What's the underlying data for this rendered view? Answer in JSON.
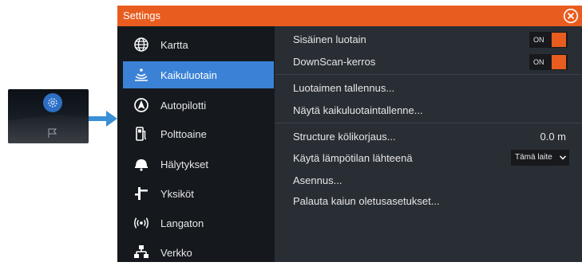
{
  "window": {
    "title": "Settings"
  },
  "sidebar": {
    "items": [
      {
        "label": "Kartta",
        "icon": "globe-icon"
      },
      {
        "label": "Kaikuluotain",
        "icon": "sonar-icon",
        "active": true
      },
      {
        "label": "Autopilotti",
        "icon": "autopilot-icon"
      },
      {
        "label": "Polttoaine",
        "icon": "fuel-icon"
      },
      {
        "label": "Hälytykset",
        "icon": "alarm-icon"
      },
      {
        "label": "Yksiköt",
        "icon": "units-icon"
      },
      {
        "label": "Langaton",
        "icon": "wireless-icon"
      },
      {
        "label": "Verkko",
        "icon": "network-icon"
      }
    ]
  },
  "main": {
    "rows": [
      {
        "label": "Sisäinen luotain",
        "toggle": "ON"
      },
      {
        "label": "DownScan-kerros",
        "toggle": "ON"
      },
      {
        "label": "Luotaimen tallennus..."
      },
      {
        "label": "Näytä kaikuluotaintallenne..."
      },
      {
        "label": "Structure kölikorjaus...",
        "value": "0.0 m"
      },
      {
        "label": "Käytä lämpötilan lähteenä",
        "select": "Tämä laite"
      },
      {
        "label": "Asennus..."
      },
      {
        "label": "Palauta kaiun oletusasetukset..."
      }
    ]
  },
  "colors": {
    "accent": "#e85d1f",
    "selection": "#3b82d6",
    "arrow": "#3b8fd6"
  },
  "thumbnail": {
    "icons": [
      "settings-gear-icon",
      "flag-icon"
    ]
  }
}
